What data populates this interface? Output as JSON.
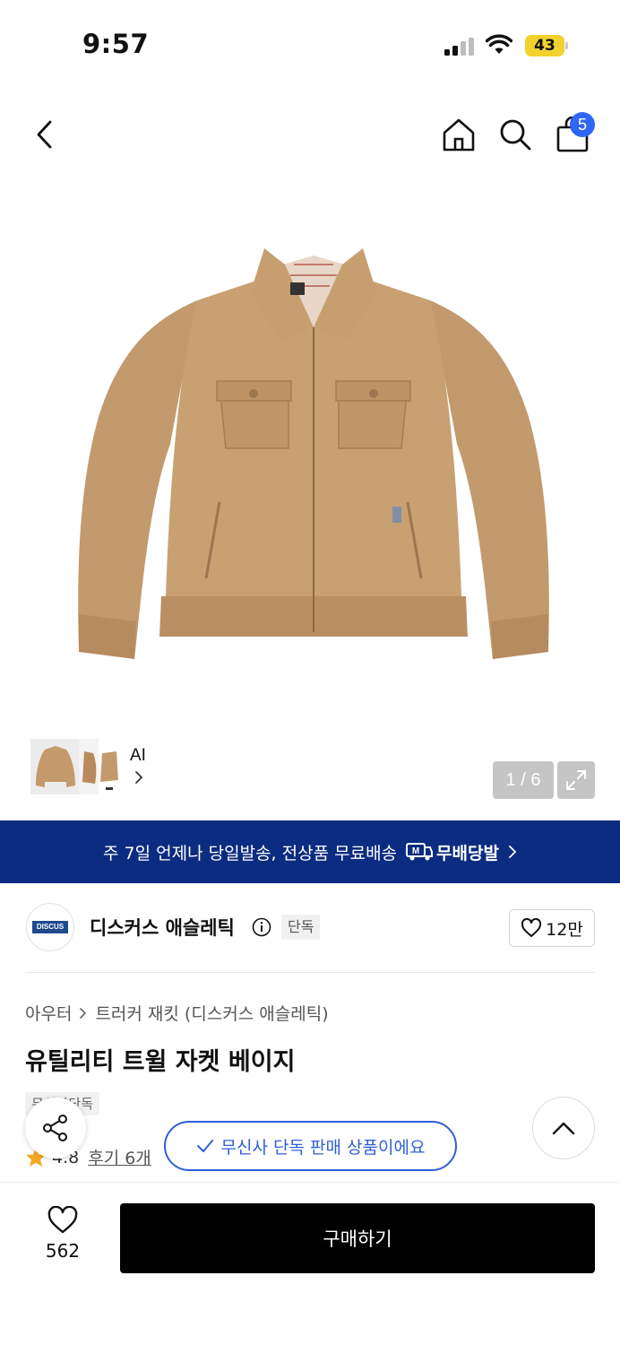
{
  "status_bar": {
    "time": "9:57",
    "battery": "43"
  },
  "header": {
    "cart_count": "5"
  },
  "gallery": {
    "ai_label": "AI",
    "page_counter": "1 / 6"
  },
  "banner": {
    "text": "주 7일 언제나 당일발송, 전상품 무료배송",
    "badge": "무배당발"
  },
  "brand": {
    "logo_text": "DISCUS",
    "name": "디스커스 애슬레틱",
    "tag": "단독",
    "like_count": "12만"
  },
  "product": {
    "breadcrumb": [
      "아우터",
      "트러커 재킷 (디스커스 애슬레틱)"
    ],
    "title": "유틸리티 트윌 자켓 베이지",
    "tag_partial": "무신사단독",
    "rating": "4.8",
    "reviews": "후기 6개"
  },
  "exclusive_notice": "무신사 단독 판매 상품이에요",
  "bottom": {
    "wish_count": "562",
    "buy_label": "구매하기"
  },
  "colors": {
    "banner_bg": "#0b2c80",
    "accent_blue": "#2f5fd8",
    "badge_blue": "#2f66f5",
    "battery_yellow": "#f2d22e",
    "star": "#f5a623",
    "jacket": "#c49a6c"
  }
}
